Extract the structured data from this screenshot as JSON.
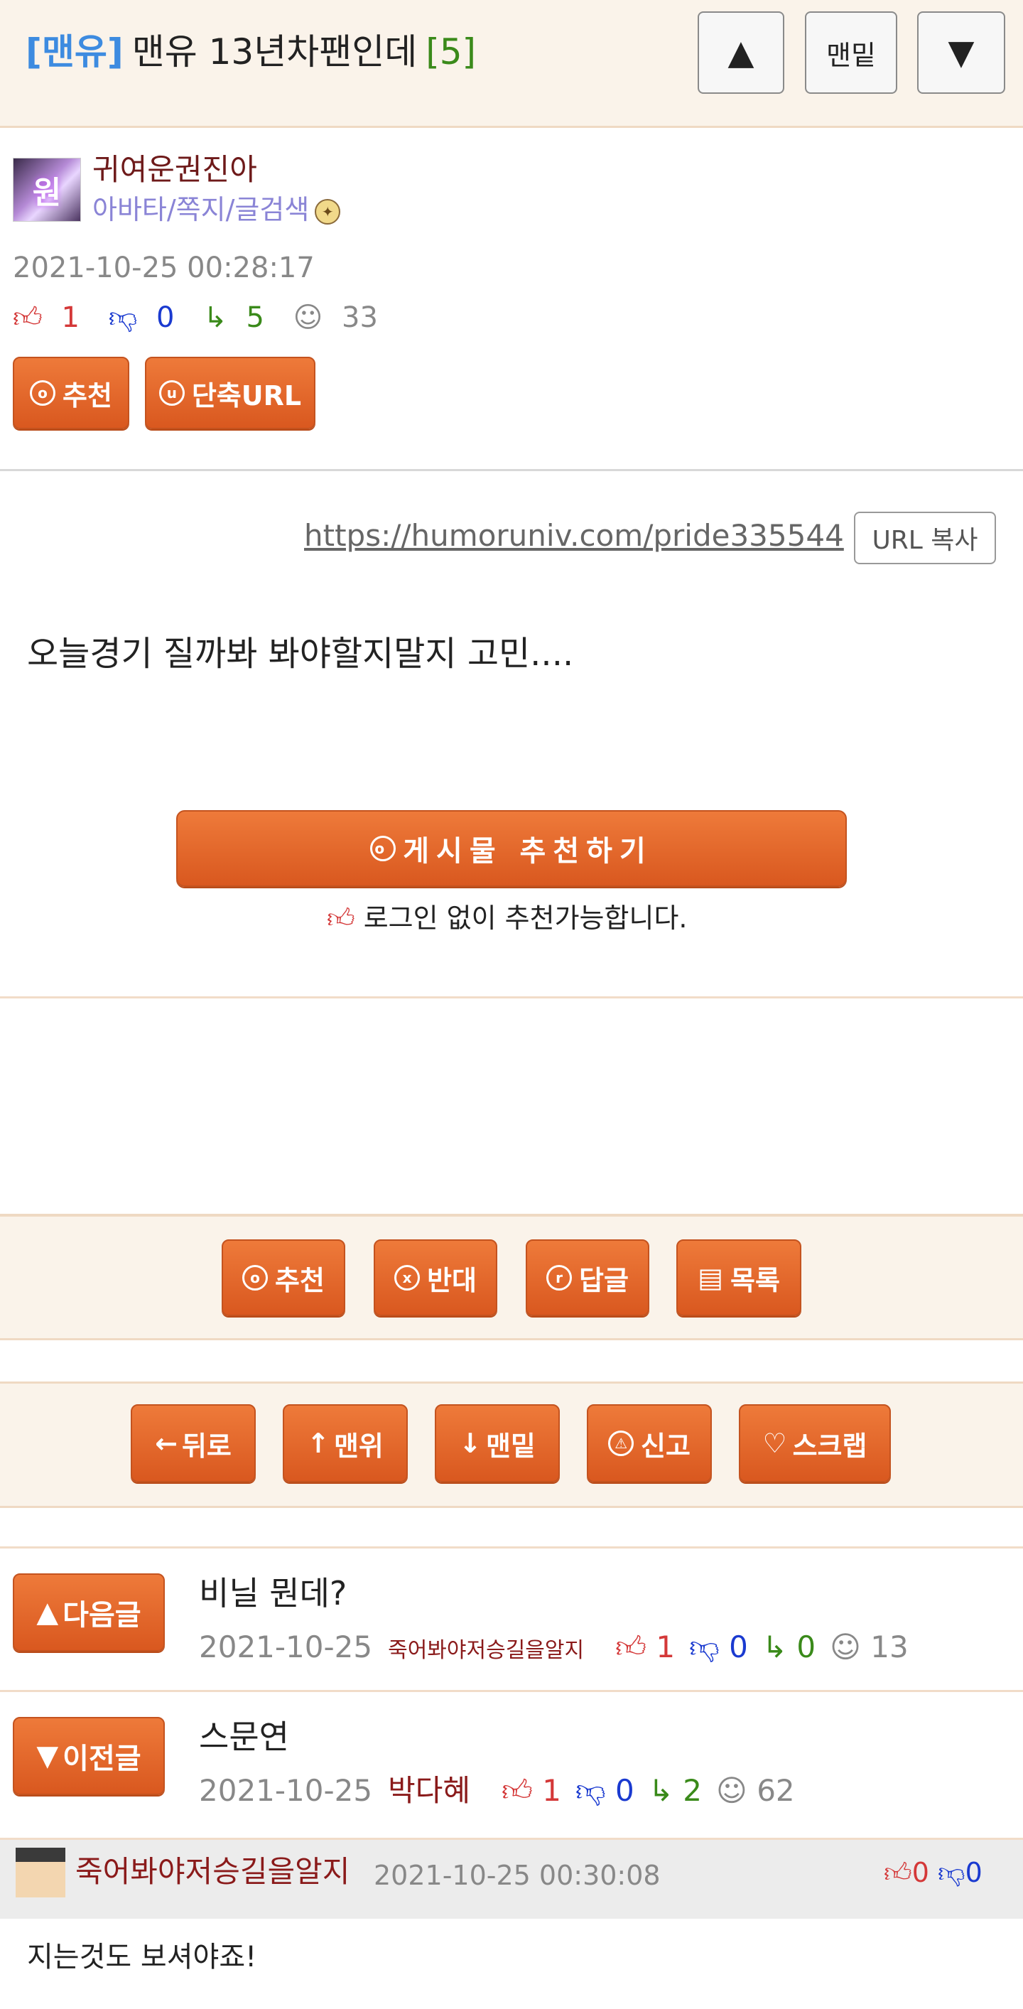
{
  "header": {
    "category": "[맨유]",
    "title": "맨유 13년차팬인데",
    "reply_count": "[5]",
    "btn_up": "▲",
    "btn_bottom": "맨밑",
    "btn_down": "▼"
  },
  "author": {
    "avatar_text": "원",
    "name": "귀여운권진아",
    "links": "아바타/쪽지/글검색",
    "date": "2021-10-25 00:28:17",
    "likes": "1",
    "dislikes": "0",
    "replies": "5",
    "views": "33"
  },
  "post_buttons": {
    "recommend": "추천",
    "short_url": "단축URL"
  },
  "url": {
    "link": "https://humoruniv.com/pride335544",
    "copy_label": "URL 복사"
  },
  "content": {
    "text": "오늘경기 질까봐 봐야할지말지 고민...."
  },
  "recommend_box": {
    "button": "게시물 추천하기",
    "note": "로그인 없이 추천가능합니다."
  },
  "action_bar": {
    "recommend": "추천",
    "against": "반대",
    "reply": "답글",
    "list": "목록"
  },
  "nav_bar": {
    "back": "뒤로",
    "top": "맨위",
    "bottom": "맨밑",
    "report": "신고",
    "scrap": "스크랩"
  },
  "next_post": {
    "label": "다음글",
    "title": "비닐 뭔데?",
    "date": "2021-10-25",
    "author": "죽어봐야저승길을알지",
    "likes": "1",
    "dislikes": "0",
    "replies": "0",
    "views": "13"
  },
  "prev_post": {
    "label": "이전글",
    "title": "스문연",
    "date": "2021-10-25",
    "author": "박다혜",
    "likes": "1",
    "dislikes": "0",
    "replies": "2",
    "views": "62"
  },
  "comment": {
    "author": "죽어봐야저승길을알지",
    "date": "2021-10-25 00:30:08",
    "likes": "0",
    "dislikes": "0",
    "text": "지는것도 보셔야죠!"
  },
  "icons": {
    "thumb_up": "thumb-up-icon",
    "thumb_down": "thumb-down-icon",
    "reply": "reply-arrow-icon",
    "views": "smiley-icon",
    "medal": "medal-icon"
  },
  "colors": {
    "accent_orange": "#e0642a",
    "category_blue": "#3d8be0",
    "like_red": "#d43838",
    "dislike_blue": "#1a3ad0",
    "reply_green": "#3a8a1a",
    "header_bg": "#faf3ea"
  }
}
